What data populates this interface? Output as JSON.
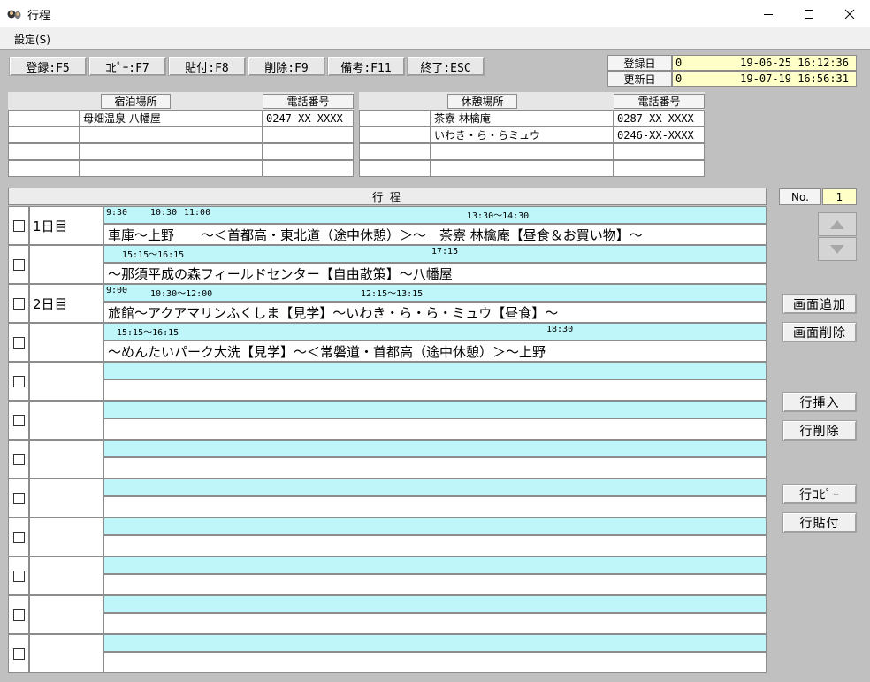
{
  "window": {
    "title": "行程",
    "minimize_icon": "minimize-icon",
    "maximize_icon": "maximize-icon",
    "close_icon": "close-icon"
  },
  "menu": {
    "settings": "設定(S)"
  },
  "toolbar": {
    "register": "登録:F5",
    "copy": "ｺﾋﾟｰ:F7",
    "paste": "貼付:F8",
    "delete": "削除:F9",
    "notes": "備考:F11",
    "exit": "終了:ESC"
  },
  "dates": {
    "registered_label": "登録日",
    "registered_code": "0",
    "registered_value": "19-06-25 16:12:36",
    "updated_label": "更新日",
    "updated_code": "0",
    "updated_value": "19-07-19 16:56:31"
  },
  "lodging": {
    "header_place": "宿泊場所",
    "header_phone": "電話番号",
    "rows": [
      {
        "code": "",
        "place": "母畑温泉 八幡屋",
        "phone": "0247-XX-XXXX"
      },
      {
        "code": "",
        "place": "",
        "phone": ""
      },
      {
        "code": "",
        "place": "",
        "phone": ""
      },
      {
        "code": "",
        "place": "",
        "phone": ""
      }
    ]
  },
  "rest": {
    "header_place": "休憩場所",
    "header_phone": "電話番号",
    "rows": [
      {
        "code": "",
        "place": "茶寮 林檎庵",
        "phone": "0287-XX-XXXX"
      },
      {
        "code": "",
        "place": "いわき・ら・らミュウ",
        "phone": "0246-XX-XXXX"
      },
      {
        "code": "",
        "place": "",
        "phone": ""
      },
      {
        "code": "",
        "place": "",
        "phone": ""
      }
    ]
  },
  "itinerary": {
    "header": "行 程",
    "rows": [
      {
        "day": "1日目",
        "times": [
          "9:30",
          "10:30",
          "11:00",
          "13:30〜14:30"
        ],
        "text": "車庫〜上野　　〜＜首都高・東北道（途中休憩）＞〜　茶寮 林檎庵【昼食＆お買い物】〜"
      },
      {
        "day": "",
        "times": [
          "15:15〜16:15",
          "17:15"
        ],
        "text": "〜那須平成の森フィールドセンター【自由散策】〜八幡屋"
      },
      {
        "day": "2日目",
        "times": [
          "9:00",
          "10:30〜12:00",
          "12:15〜13:15"
        ],
        "text": "旅館〜アクアマリンふくしま【見学】〜いわき・ら・ら・ミュウ【昼食】〜"
      },
      {
        "day": "",
        "times": [
          "15:15〜16:15",
          "18:30"
        ],
        "text": "〜めんたいパーク大洗【見学】〜＜常磐道・首都高（途中休憩）＞〜上野"
      },
      {
        "day": "",
        "times": [],
        "text": ""
      },
      {
        "day": "",
        "times": [],
        "text": ""
      },
      {
        "day": "",
        "times": [],
        "text": ""
      },
      {
        "day": "",
        "times": [],
        "text": ""
      },
      {
        "day": "",
        "times": [],
        "text": ""
      },
      {
        "day": "",
        "times": [],
        "text": ""
      },
      {
        "day": "",
        "times": [],
        "text": ""
      },
      {
        "day": "",
        "times": [],
        "text": ""
      }
    ]
  },
  "side": {
    "no_label": "No.",
    "no_value": "1",
    "add_screen": "画面追加",
    "delete_screen": "画面削除",
    "insert_row": "行挿入",
    "delete_row": "行削除",
    "copy_row": "行ｺﾋﾟｰ",
    "paste_row": "行貼付"
  }
}
